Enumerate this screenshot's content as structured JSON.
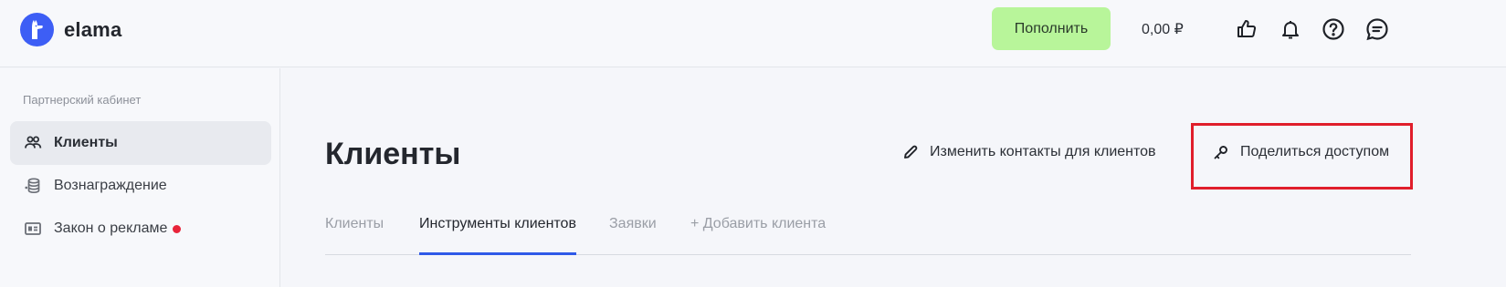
{
  "header": {
    "logo_text": "elama",
    "topup_label": "Пополнить",
    "balance": "0,00 ₽",
    "icons": [
      "thumbs-up-icon",
      "bell-icon",
      "help-icon",
      "chat-icon"
    ]
  },
  "sidebar": {
    "heading": "Партнерский кабинет",
    "items": [
      {
        "label": "Клиенты",
        "icon": "users-icon",
        "active": true
      },
      {
        "label": "Вознаграждение",
        "icon": "coins-icon",
        "active": false
      },
      {
        "label": "Закон о рекламе",
        "icon": "id-card-icon",
        "active": false,
        "badge": "red-dot"
      }
    ]
  },
  "main": {
    "title": "Клиенты",
    "edit_contacts_label": "Изменить контакты для клиентов",
    "share_access_label": "Поделиться доступом",
    "tabs": [
      {
        "label": "Клиенты",
        "active": false
      },
      {
        "label": "Инструменты клиентов",
        "active": true
      },
      {
        "label": "Заявки",
        "active": false
      },
      {
        "label": "+ Добавить клиента",
        "active": false
      }
    ]
  },
  "colors": {
    "accent": "#2f59e8",
    "logo": "#3d5ef5",
    "topup_button": "#b8f59a",
    "highlight": "#e01e2b",
    "badge": "#e8243a"
  }
}
